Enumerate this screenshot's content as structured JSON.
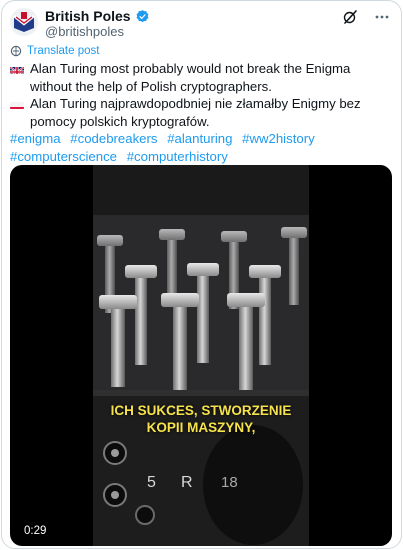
{
  "post": {
    "display_name": "British Poles",
    "handle": "@britishpoles",
    "translate_label": "Translate post",
    "text_en": "Alan Turing most probably would not break the Enigma without the help of Polish cryptographers.",
    "text_pl": "Alan Turing najprawdopodbniej nie złamałby Enigmy bez pomocy polskich kryptografów.",
    "hashtags": [
      "#enigma",
      "#codebreakers",
      "#alanturing",
      "#ww2history",
      "#computerscience",
      "#computerhistory"
    ]
  },
  "video": {
    "subtitle_line1": "ICH SUKCES, STWORZENIE",
    "subtitle_line2": "KOPII MASZYNY,",
    "timecode": "0:29",
    "key_label_number": "5",
    "key_label_letter": "R",
    "key_label_number2": "18"
  },
  "colors": {
    "link": "#1d9bf0",
    "subtitle": "#f6e24a",
    "verified": "#1d9bf0"
  },
  "icons": {
    "verified": "verified-badge-icon",
    "grok": "grok-icon",
    "more": "more-icon",
    "translate": "translate-icon"
  }
}
